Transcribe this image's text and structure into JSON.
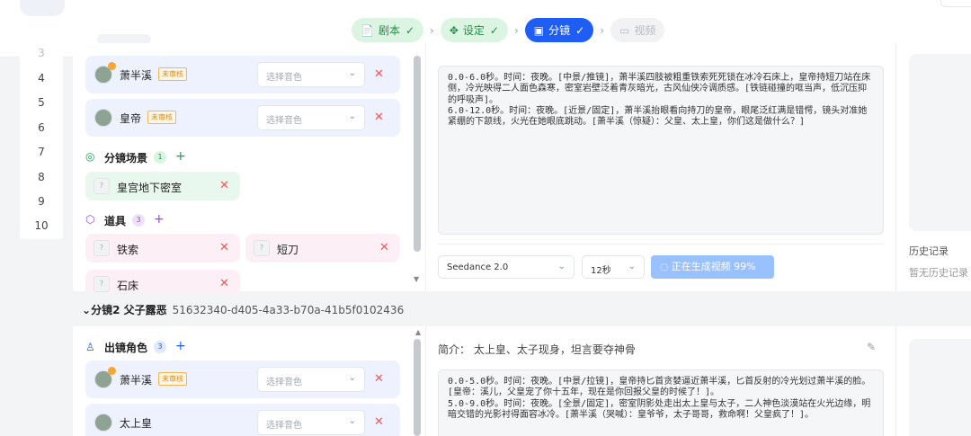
{
  "steps": [
    {
      "icon": "📄",
      "label": "剧本",
      "check": "✓"
    },
    {
      "icon": "✥",
      "label": "设定",
      "check": "✓"
    },
    {
      "icon": "▣",
      "label": "分镜",
      "check": "✓"
    },
    {
      "icon": "▭",
      "label": "视频"
    }
  ],
  "line_numbers": [
    "3",
    "4",
    "5",
    "6",
    "7",
    "8",
    "9",
    "10"
  ],
  "shot1": {
    "roles": [
      {
        "name": "萧半溪",
        "badge": "未审核",
        "voice_placeholder": "选择音色"
      },
      {
        "name": "皇帝",
        "badge": "未审核",
        "voice_placeholder": "选择音色"
      }
    ],
    "scenes_title": "分镜场景",
    "scenes_count": "1",
    "scenes": [
      {
        "name": "皇宫地下密室"
      }
    ],
    "props_title": "道具",
    "props_count": "3",
    "props": [
      {
        "name": "铁索"
      },
      {
        "name": "短刀"
      },
      {
        "name": "石床"
      }
    ],
    "script": "0.0-6.0秒。时间：夜晚。[中景/推镜]，萧半溪四肢被粗重铁索死死锁在冰冷石床上，皇帝持短刀站在床侧，冷光映得二人面色森寒，密室岩壁泛着青灰暗光，古风仙侠冷调质感。[铁链碰撞的哐当声，低沉压抑的呼吸声]。\n6.0-12.0秒。时间：夜晚。[近景/固定]，萧半溪抬眼看向持刀的皇帝，眼尾泛红满是错愕，镜头对准她紧绷的下颔线，火光在她眼底跳动。[萧半溪（惊疑）：父皇、太上皇，你们这是做什么？]",
    "model": "Seedance 2.0",
    "duration": "12秒",
    "generate_label": "正在生成视频 99%",
    "history_title": "历史记录",
    "history_empty": "暂无历史记录"
  },
  "shot2": {
    "header_title": "分镜2 父子露恶",
    "header_id": "51632340-d405-4a33-b70a-41b5f0102436",
    "roles_title": "出镜角色",
    "roles_count": "3",
    "roles": [
      {
        "name": "萧半溪",
        "badge": "未审核",
        "voice_placeholder": "选择音色"
      },
      {
        "name": "太上皇",
        "voice_placeholder": "选择音色"
      }
    ],
    "summary_label": "简介：",
    "summary_text": "太上皇、太子现身，坦言要夺神骨",
    "script": "0.0-5.0秒。时间：夜晚。[中景/拉镜]，皇帝持匕首贪婪逼近萧半溪，匕首反射的冷光划过萧半溪的脸。[皇帝：溪儿，父皇宠了你十五年，现在是你回报父皇的时候了！]。\n5.0-9.0秒。时间：夜晚。[全景/固定]，密室阴影处走出太上皇与太子，二人神色淡漠站在火光边缘，明暗交错的光影衬得面容冰冷。[萧半溪（哭喊）：皇爷爷，太子哥哥，救命啊！父皇疯了！]。"
  },
  "colors": {
    "accent": "#1f5ef5",
    "done": "#1d8f43",
    "danger": "#ee5a5a"
  }
}
